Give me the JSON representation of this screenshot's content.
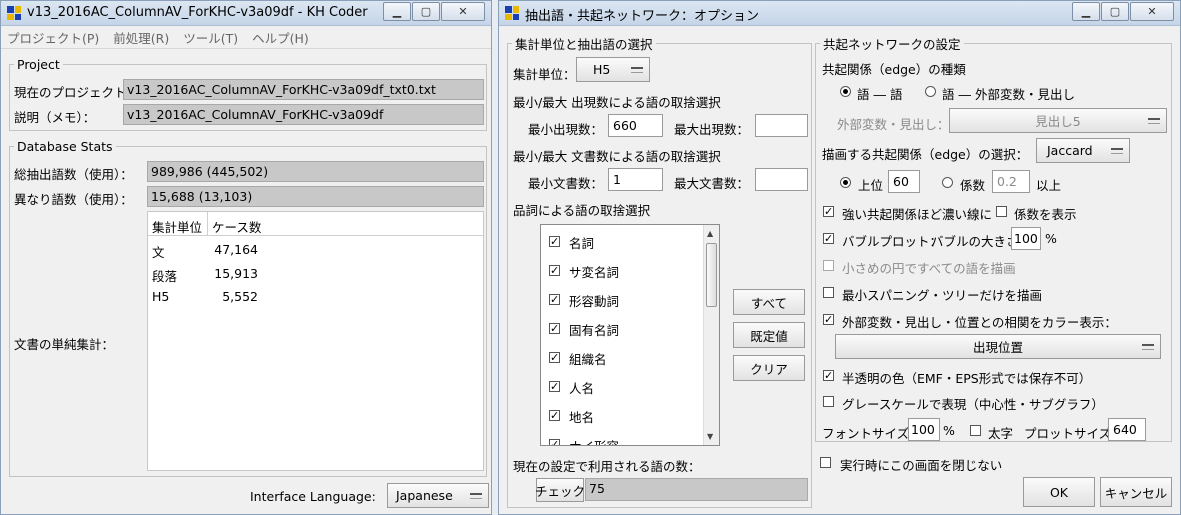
{
  "main_window": {
    "title": "v13_2016AC_ColumnAV_ForKHC-v3a09df - KH Coder",
    "menu": [
      "プロジェクト(P)",
      "前処理(R)",
      "ツール(T)",
      "ヘルプ(H)"
    ],
    "project": {
      "legend": "Project",
      "current_label": "現在のプロジェクト：",
      "current_value": "v13_2016AC_ColumnAV_ForKHC-v3a09df_txt0.txt",
      "memo_label": "説明（メモ）：",
      "memo_value": "v13_2016AC_ColumnAV_ForKHC-v3a09df"
    },
    "stats": {
      "legend": "Database Stats",
      "total_label": "総抽出語数（使用）：",
      "total_value": "989,986 (445,502)",
      "distinct_label": "異なり語数（使用）：",
      "distinct_value": "15,688 (13,103)",
      "simple_count_label": "文書の単純集計：",
      "table_headers": [
        "集計単位",
        "ケース数"
      ],
      "table_rows": [
        {
          "unit": "文",
          "count": "47,164"
        },
        {
          "unit": "段落",
          "count": "15,913"
        },
        {
          "unit": "H5",
          "count": "5,552"
        }
      ]
    },
    "interface_language_label": "Interface Language:",
    "interface_language_value": "Japanese"
  },
  "options_window": {
    "title": "抽出語・共起ネットワーク：オプション",
    "left_panel": {
      "legend": "集計単位と抽出語の選択",
      "unit_label": "集計単位：",
      "unit_value": "H5",
      "freq_heading": "最小/最大 出現数による語の取捨選択",
      "min_freq_label": "最小出現数：",
      "min_freq_value": "660",
      "max_freq_label": "最大出現数：",
      "max_freq_value": "",
      "doc_heading": "最小/最大 文書数による語の取捨選択",
      "min_doc_label": "最小文書数：",
      "min_doc_value": "1",
      "max_doc_label": "最大文書数：",
      "max_doc_value": "",
      "pos_heading": "品詞による語の取捨選択",
      "pos_items": [
        "名詞",
        "サ変名詞",
        "形容動詞",
        "固有名詞",
        "組織名",
        "人名",
        "地名",
        "ナイ形容"
      ],
      "all_button": "すべて",
      "default_button": "既定値",
      "clear_button": "クリア",
      "count_heading": "現在の設定で利用される語の数：",
      "check_button": "チェック",
      "count_value": "75"
    },
    "right_panel": {
      "legend": "共起ネットワークの設定",
      "edge_type_label": "共起関係（edge）の種類",
      "edge_word_word": "語 ― 語",
      "edge_word_ext": "語 ― 外部変数・見出し",
      "ext_var_label": "外部変数・見出し：",
      "ext_var_value": "見出し5",
      "draw_edge_label": "描画する共起関係（edge）の選択：",
      "draw_edge_value": "Jaccard",
      "top_label": "上位",
      "top_value": "60",
      "coef_label": "係数",
      "coef_value": "0.2",
      "above_label": "以上",
      "thick_lines_label": "強い共起関係ほど濃い線に",
      "show_coef_label": "係数を表示",
      "bubble_label": "バブルプロット：",
      "bubble_size_label": "バブルの大きさ",
      "bubble_size_value": "100",
      "percent": "%",
      "small_circle_label": "小さめの円ですべての語を描画",
      "mst_label": "最小スパニング・ツリーだけを描画",
      "color_corr_label": "外部変数・見出し・位置との相関をカラー表示：",
      "color_corr_value": "出現位置",
      "translucent_label": "半透明の色（EMF・EPS形式では保存不可）",
      "grayscale_label": "グレースケールで表現（中心性・サブグラフ）",
      "font_size_label": "フォントサイズ：",
      "font_size_value": "100",
      "bold_label": "太字",
      "plot_size_label": "プロットサイズ：",
      "plot_size_value": "640"
    },
    "close_on_run_label": "実行時にこの画面を閉じない",
    "ok_button": "OK",
    "cancel_button": "キャンセル"
  }
}
